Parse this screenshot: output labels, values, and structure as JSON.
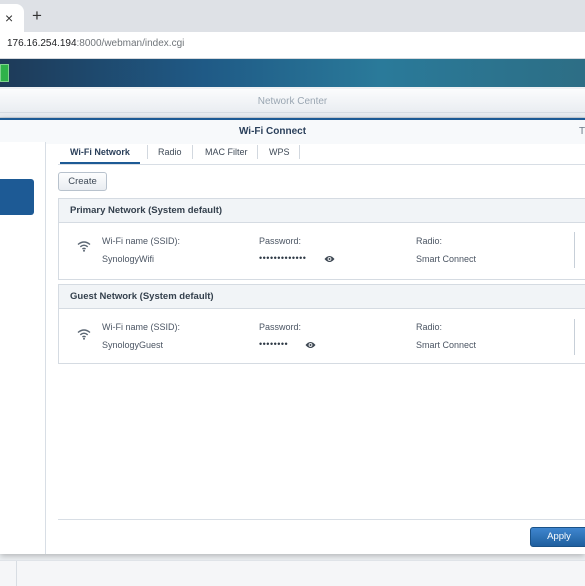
{
  "browser": {
    "close_glyph": "×",
    "new_tab_glyph": "+",
    "url_host": "176.16.254.194",
    "url_path": ":8000/webman/index.cgi"
  },
  "outer_window": {
    "title": "Network Center"
  },
  "inner_window": {
    "title": "Wi-Fi Connect",
    "title_right": "T"
  },
  "tabs": [
    "Wi-Fi Network",
    "Radio",
    "MAC Filter",
    "WPS"
  ],
  "create_label": "Create",
  "networks": [
    {
      "title": "Primary Network (System default)",
      "ssid_label": "Wi-Fi name (SSID):",
      "ssid": "SynologyWifi",
      "password_label": "Password:",
      "password_mask": "•••••••••••••",
      "radio_label": "Radio:",
      "radio": "Smart Connect"
    },
    {
      "title": "Guest Network (System default)",
      "ssid_label": "Wi-Fi name (SSID):",
      "ssid": "SynologyGuest",
      "password_label": "Password:",
      "password_mask": "••••••••",
      "radio_label": "Radio:",
      "radio": "Smart Connect"
    }
  ],
  "apply_label": "Apply",
  "colors": {
    "accent": "#1d5a95",
    "apply": "#2f73b8"
  },
  "icons": [
    "close-icon",
    "plus-icon",
    "wifi-icon",
    "eye-icon",
    "app-icon"
  ]
}
